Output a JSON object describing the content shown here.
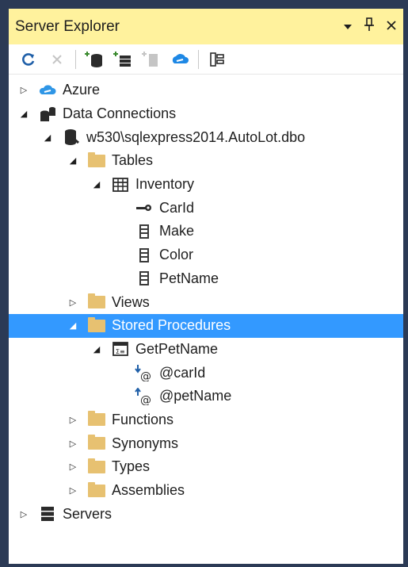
{
  "window": {
    "title": "Server Explorer",
    "controls": {
      "dropdown": "▾",
      "pin": "🖈",
      "close": "✕"
    }
  },
  "toolbar": [
    {
      "icon": "refresh-icon"
    },
    {
      "icon": "stop-icon"
    },
    {
      "icon": "add-connection-icon"
    },
    {
      "icon": "connect-to-server-icon"
    },
    {
      "icon": "new-query-icon"
    },
    {
      "icon": "connect-to-azure-icon"
    },
    {
      "icon": "properties-icon"
    }
  ],
  "tree": {
    "azure": "Azure",
    "data_connections": "Data Connections",
    "connection": "w530\\sqlexpress2014.AutoLot.dbo",
    "tables": "Tables",
    "inventory": "Inventory",
    "carid": "CarId",
    "make": "Make",
    "color": "Color",
    "petname": "PetName",
    "views": "Views",
    "stored_procedures": "Stored Procedures",
    "getpetname": "GetPetName",
    "param_carid": "@carId",
    "param_petname": "@petName",
    "functions": "Functions",
    "synonyms": "Synonyms",
    "types": "Types",
    "assemblies": "Assemblies",
    "servers": "Servers"
  },
  "colors": {
    "title_bg": "#fff29d",
    "selection": "#3399ff",
    "folder": "#e7c171",
    "frame": "#2b3a55"
  }
}
